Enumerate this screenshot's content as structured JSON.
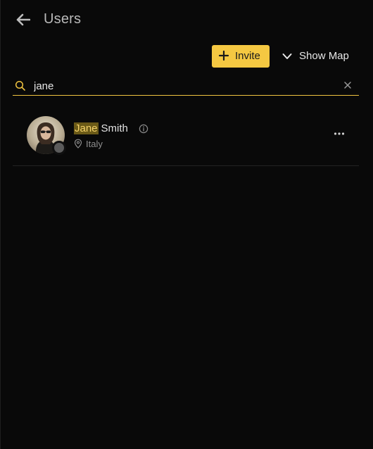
{
  "header": {
    "title": "Users",
    "back_icon": "arrow-left-icon"
  },
  "toolbar": {
    "invite_label": "Invite",
    "invite_icon": "plus-icon",
    "show_map_label": "Show Map",
    "show_map_icon": "chevron-down-icon"
  },
  "search": {
    "value": "jane",
    "placeholder": "",
    "icon": "search-icon",
    "clear_icon": "close-icon"
  },
  "users": [
    {
      "name_match": "Jane",
      "name_rest": "Smith",
      "location": "Italy",
      "status": "offline"
    }
  ],
  "colors": {
    "accent": "#f5c842",
    "background": "#090909",
    "highlight_bg": "#6b5a17",
    "status_dot": "#5b5b5b"
  }
}
